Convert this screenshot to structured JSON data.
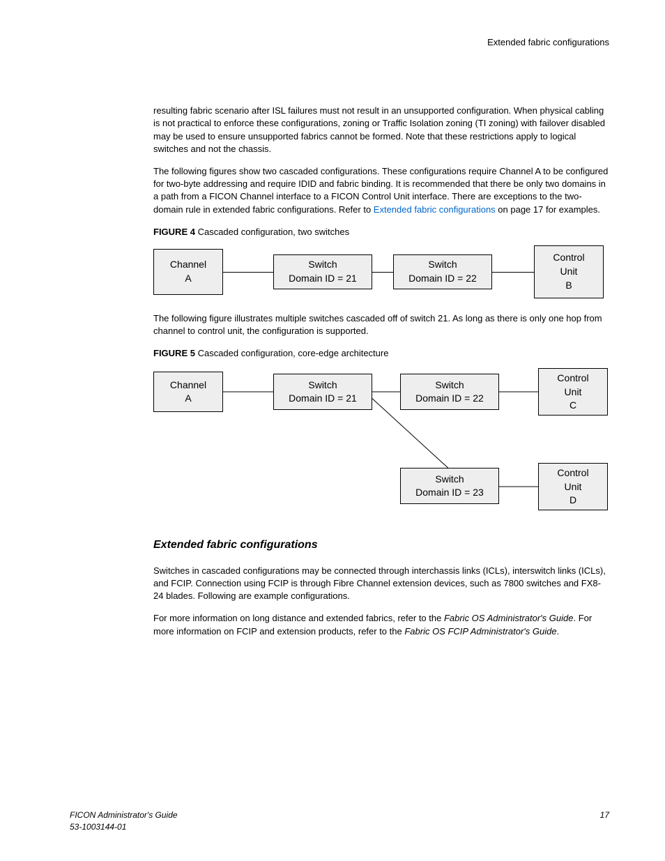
{
  "header": {
    "right": "Extended fabric configurations"
  },
  "para1": "resulting fabric scenario after ISL failures must not result in an unsupported configuration. When physical cabling is not practical to enforce these configurations, zoning or Traffic Isolation zoning (TI zoning) with failover disabled may be used to ensure unsupported fabrics cannot be formed. Note that these restrictions apply to logical switches and not the chassis.",
  "para2a": "The following figures show two cascaded configurations. These configurations require Channel A to be configured for two-byte addressing and require IDID and fabric binding. It is recommended that there be only two domains in a path from a FICON Channel interface to a FICON Control Unit interface. There are exceptions to the two-domain rule in extended fabric configurations. Refer to ",
  "para2_link": "Extended fabric configurations",
  "para2b": " on page 17 for examples.",
  "fig4": {
    "label": "FIGURE 4",
    "caption": " Cascaded configuration, two switches",
    "channel_line1": "Channel",
    "channel_line2": "A",
    "switch1_line1": "Switch",
    "switch1_line2": "Domain ID = 21",
    "switch2_line1": "Switch",
    "switch2_line2": "Domain ID = 22",
    "cu_line1": "Control",
    "cu_line2": "Unit",
    "cu_line3": "B"
  },
  "para3": "The following figure illustrates multiple switches cascaded off of switch 21. As long as there is only one hop from channel to control unit, the configuration is supported.",
  "fig5": {
    "label": "FIGURE 5",
    "caption": " Cascaded configuration, core-edge architecture",
    "channel_line1": "Channel",
    "channel_line2": "A",
    "switch1_line1": "Switch",
    "switch1_line2": "Domain ID = 21",
    "switch2_line1": "Switch",
    "switch2_line2": "Domain ID = 22",
    "switch3_line1": "Switch",
    "switch3_line2": "Domain ID = 23",
    "cu1_line1": "Control",
    "cu1_line2": "Unit",
    "cu1_line3": "C",
    "cu2_line1": "Control",
    "cu2_line2": "Unit",
    "cu2_line3": "D"
  },
  "section": {
    "heading": "Extended fabric configurations"
  },
  "para4": "Switches in cascaded configurations may be connected through interchassis links (ICLs), interswitch links (ICLs), and FCIP. Connection using FCIP is through Fibre Channel extension devices, such as 7800 switches and FX8-24 blades. Following are example configurations.",
  "para5a": "For more information on long distance and extended fabrics, refer to the ",
  "para5_ref1": "Fabric OS Administrator's Guide",
  "para5b": ". For more information on FCIP and extension products, refer to the ",
  "para5_ref2": "Fabric OS FCIP Administrator's Guide",
  "para5c": ".",
  "footer": {
    "title": "FICON Administrator's Guide",
    "docnum": "53-1003144-01",
    "page": "17"
  }
}
